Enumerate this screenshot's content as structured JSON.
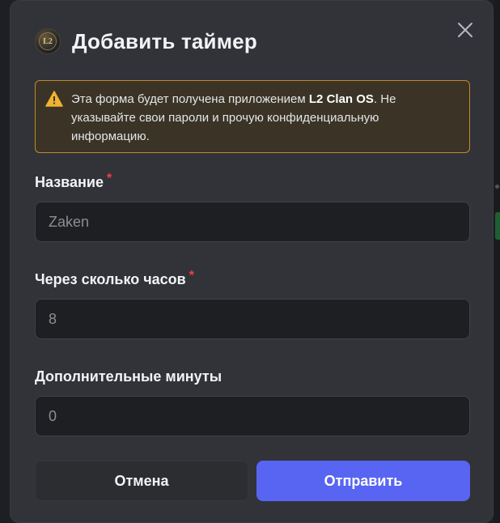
{
  "modal": {
    "title": "Добавить таймер",
    "logo_icon": "app-logo-icon",
    "logo_glyph": "L2",
    "close_icon": "close-icon"
  },
  "warning": {
    "icon": "warning-triangle-icon",
    "text_before": "Эта форма будет получена приложением ",
    "app_name": "L2 Clan OS",
    "text_after": ". Не указывайте свои пароли и прочую конфиденциальную информацию."
  },
  "fields": [
    {
      "label": "Название",
      "required_mark": "*",
      "value": "",
      "placeholder": "Zaken"
    },
    {
      "label": "Через сколько часов",
      "required_mark": "*",
      "value": "",
      "placeholder": "8"
    },
    {
      "label": "Дополнительные минуты",
      "required_mark": "",
      "value": "",
      "placeholder": "0"
    }
  ],
  "buttons": {
    "cancel_label": "Отмена",
    "submit_label": "Отправить"
  },
  "colors": {
    "accent": "#5865f2",
    "warning_border": "#c2872a",
    "required": "#f23f43"
  }
}
